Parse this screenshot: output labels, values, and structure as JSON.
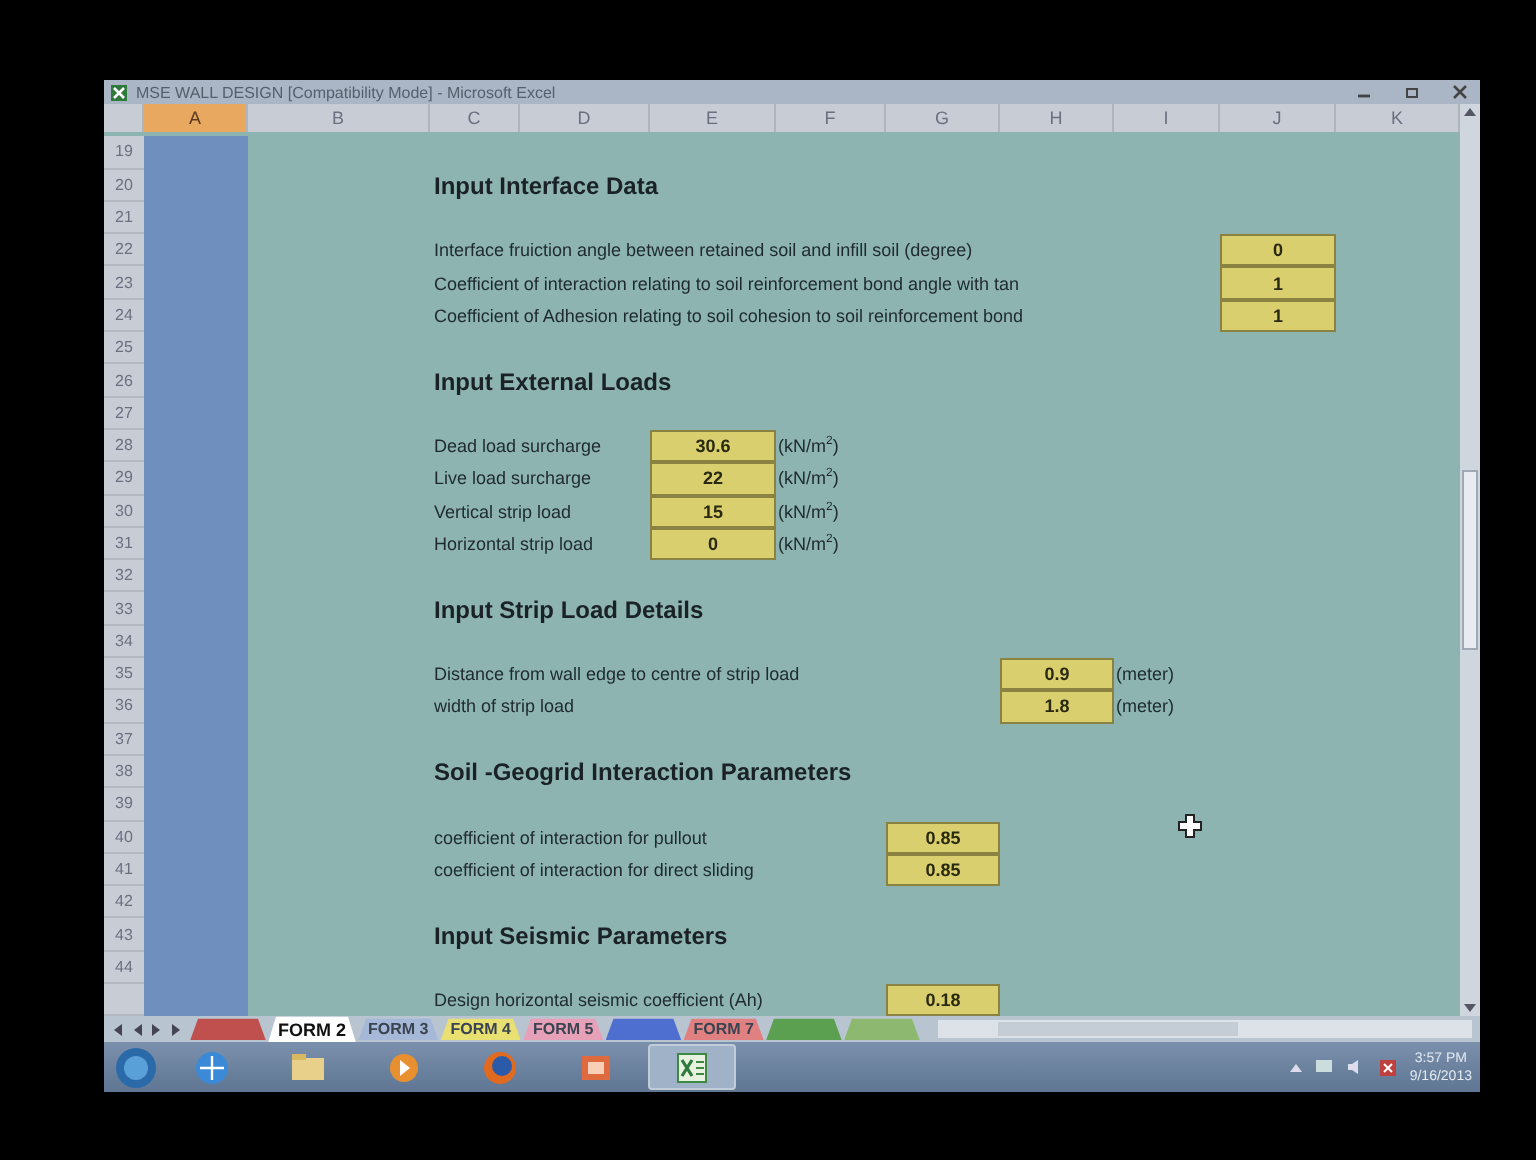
{
  "window": {
    "title": "MSE WALL DESIGN [Compatibility Mode] - Microsoft Excel"
  },
  "columns": [
    {
      "label": "A",
      "selected": true
    },
    {
      "label": "B",
      "selected": false
    },
    {
      "label": "C",
      "selected": false
    },
    {
      "label": "D",
      "selected": false
    },
    {
      "label": "E",
      "selected": false
    },
    {
      "label": "F",
      "selected": false
    },
    {
      "label": "G",
      "selected": false
    },
    {
      "label": "H",
      "selected": false
    },
    {
      "label": "I",
      "selected": false
    },
    {
      "label": "J",
      "selected": false
    },
    {
      "label": "K",
      "selected": false
    }
  ],
  "rows": [
    {
      "number": "19"
    },
    {
      "number": "20",
      "kind": "heading",
      "text": "Input Interface Data"
    },
    {
      "number": "21"
    },
    {
      "number": "22",
      "kind": "field",
      "label": "Interface fruiction angle between retained soil and infill soil (degree)",
      "value": "0"
    },
    {
      "number": "23",
      "kind": "field",
      "label": "Coefficient of interaction relating to soil reinforcement bond angle with tan",
      "value": "1"
    },
    {
      "number": "24",
      "kind": "field",
      "label": "Coefficient of Adhesion relating to soil cohesion to soil reinforcement bond",
      "value": "1"
    },
    {
      "number": "25"
    },
    {
      "number": "26",
      "kind": "heading",
      "text": "Input External Loads"
    },
    {
      "number": "27"
    },
    {
      "number": "28",
      "kind": "field",
      "label": "Dead load surcharge",
      "value": "30.6",
      "unit": "(kN/m$^{2}$)"
    },
    {
      "number": "29",
      "kind": "field",
      "label": "Live load surcharge",
      "value": "22",
      "unit": "(kN/m$^{2}$)"
    },
    {
      "number": "30",
      "kind": "field",
      "label": "Vertical strip load",
      "value": "15",
      "unit": "(kN/m$^{2}$)"
    },
    {
      "number": "31",
      "kind": "field",
      "label": "Horizontal strip load",
      "value": "0",
      "unit": "(kN/m$^{2}$)"
    },
    {
      "number": "32"
    },
    {
      "number": "33",
      "kind": "heading",
      "text": "Input Strip Load Details"
    },
    {
      "number": "34"
    },
    {
      "number": "35",
      "kind": "field",
      "label": "Distance from wall edge to centre of strip load",
      "value": "0.9",
      "unit": "(meter)"
    },
    {
      "number": "36",
      "kind": "field",
      "label": "width of strip load",
      "value": "1.8",
      "unit": "(meter)"
    },
    {
      "number": "37"
    },
    {
      "number": "38",
      "kind": "heading",
      "text": "Soil -Geogrid Interaction Parameters"
    },
    {
      "number": "39"
    },
    {
      "number": "40",
      "kind": "field",
      "label": "coefficient of interaction for pullout",
      "value": "0.85"
    },
    {
      "number": "41",
      "kind": "field",
      "label": "coefficient of interaction for direct sliding",
      "value": "0.85"
    },
    {
      "number": "42"
    },
    {
      "number": "43",
      "kind": "heading",
      "text": "Input Seismic Parameters"
    },
    {
      "number": "44"
    },
    {
      "kind": "field",
      "label": "Design horizontal seismic coefficient (Ah)",
      "value": "0.18"
    }
  ],
  "sheet_tabs": [
    {
      "color": "#c0504d",
      "selected": false
    },
    {
      "label": "FORM 2",
      "color": "#ffffff",
      "selected": true
    },
    {
      "label": "FORM 3",
      "color": "#a6b8d8",
      "selected": false
    },
    {
      "label": "FORM 4",
      "color": "#e8e070",
      "selected": false
    },
    {
      "label": "FORM 5",
      "color": "#e6a0b8",
      "selected": false
    },
    {
      "color": "#4f6fd0",
      "selected": false
    },
    {
      "label": "FORM 7",
      "color": "#e08080",
      "selected": false
    },
    {
      "color": "#5aa050",
      "selected": false
    },
    {
      "color": "#8cb870",
      "selected": false
    }
  ],
  "taskbar": {
    "apps": [
      {
        "kind": "browser",
        "active": false
      },
      {
        "kind": "folder",
        "active": false
      },
      {
        "kind": "media",
        "active": false
      },
      {
        "kind": "firefox",
        "active": false
      },
      {
        "kind": "slides",
        "active": false
      },
      {
        "kind": "sheet",
        "active": true
      }
    ],
    "time": "3:57 PM",
    "date": "9/16/2013"
  }
}
